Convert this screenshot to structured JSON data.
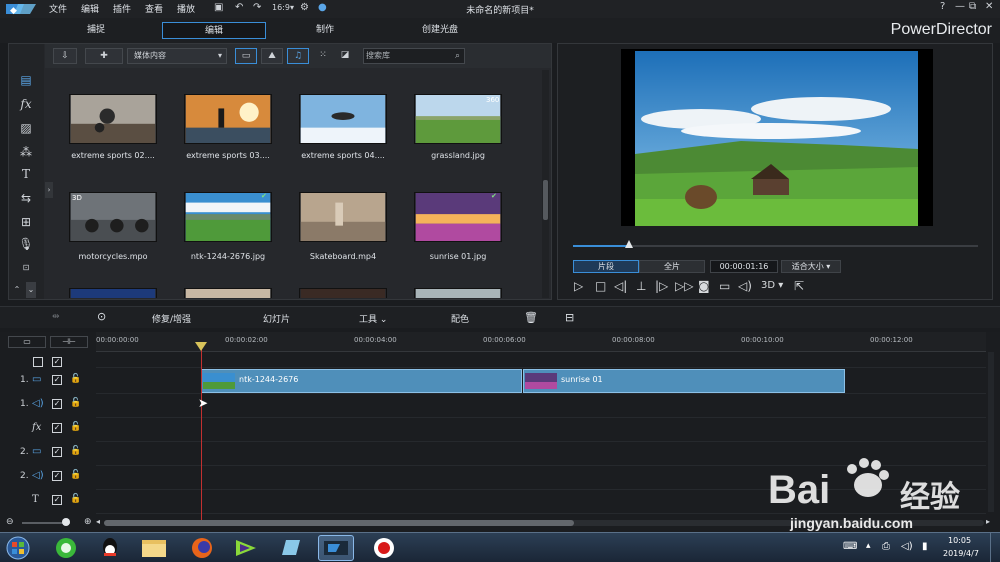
{
  "titlebar": {
    "menus": [
      "文件",
      "编辑",
      "插件",
      "查看",
      "播放"
    ],
    "title": "未命名的新项目*",
    "help": "?",
    "minimize": "—",
    "restore": "⧉",
    "close": "✕"
  },
  "tabs": [
    "捕捉",
    "编辑",
    "制作",
    "创建光盘"
  ],
  "brand": "PowerDirector",
  "library": {
    "media_filter": "媒体内容",
    "search_placeholder": "搜索库",
    "items": [
      {
        "label": "extreme sports 02....",
        "badge": ""
      },
      {
        "label": "extreme sports 03....",
        "badge": ""
      },
      {
        "label": "extreme sports 04....",
        "badge": ""
      },
      {
        "label": "grassland.jpg",
        "badge": "360"
      },
      {
        "label": "motorcycles.mpo",
        "badge": "3D"
      },
      {
        "label": "ntk-1244-2676.jpg",
        "badge": "✔"
      },
      {
        "label": "Skateboard.mp4",
        "badge": ""
      },
      {
        "label": "sunrise 01.jpg",
        "badge": "✔"
      }
    ]
  },
  "preview": {
    "clip_btn": "片段",
    "full_btn": "全片",
    "timecode": "00:00:01:16",
    "fit_label": "适合大小",
    "threed": "3D"
  },
  "edit_toolbar": {
    "fix": "修复/增强",
    "slideshow": "幻灯片",
    "tools": "工具",
    "color": "配色"
  },
  "timeline": {
    "ruler": [
      "00:00:00:00",
      "00:00:02:00",
      "00:00:04:00",
      "00:00:06:00",
      "00:00:08:00",
      "00:00:10:00",
      "00:00:12:00"
    ],
    "tracks": [
      {
        "num": "",
        "icon": "",
        "lock": false
      },
      {
        "num": "1.",
        "icon": "video",
        "lock": true
      },
      {
        "num": "1.",
        "icon": "audio",
        "lock": true
      },
      {
        "num": "",
        "icon": "fx",
        "lock": true
      },
      {
        "num": "2.",
        "icon": "video",
        "lock": true
      },
      {
        "num": "2.",
        "icon": "audio",
        "lock": true
      },
      {
        "num": "",
        "icon": "title",
        "lock": true
      }
    ],
    "clips": [
      {
        "label": "ntk-1244-2676"
      },
      {
        "label": "sunrise 01"
      }
    ]
  },
  "taskbar": {
    "time": "10:05",
    "date": "2019/4/7"
  },
  "watermark": {
    "brand": "Bai",
    "brand_cn": "经验",
    "url": "jingyan.baidu.com"
  }
}
